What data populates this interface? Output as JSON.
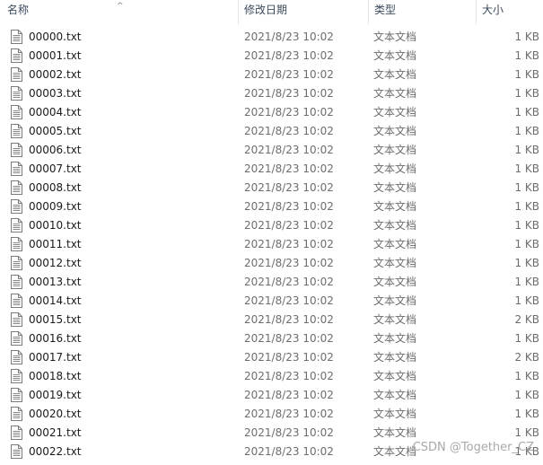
{
  "header": {
    "name": "名称",
    "date": "修改日期",
    "type": "类型",
    "size": "大小",
    "sort_indicator": "^"
  },
  "files": [
    {
      "name": "00000.txt",
      "date": "2021/8/23 10:02",
      "type": "文本文档",
      "size": "1 KB"
    },
    {
      "name": "00001.txt",
      "date": "2021/8/23 10:02",
      "type": "文本文档",
      "size": "1 KB"
    },
    {
      "name": "00002.txt",
      "date": "2021/8/23 10:02",
      "type": "文本文档",
      "size": "1 KB"
    },
    {
      "name": "00003.txt",
      "date": "2021/8/23 10:02",
      "type": "文本文档",
      "size": "1 KB"
    },
    {
      "name": "00004.txt",
      "date": "2021/8/23 10:02",
      "type": "文本文档",
      "size": "1 KB"
    },
    {
      "name": "00005.txt",
      "date": "2021/8/23 10:02",
      "type": "文本文档",
      "size": "1 KB"
    },
    {
      "name": "00006.txt",
      "date": "2021/8/23 10:02",
      "type": "文本文档",
      "size": "1 KB"
    },
    {
      "name": "00007.txt",
      "date": "2021/8/23 10:02",
      "type": "文本文档",
      "size": "1 KB"
    },
    {
      "name": "00008.txt",
      "date": "2021/8/23 10:02",
      "type": "文本文档",
      "size": "1 KB"
    },
    {
      "name": "00009.txt",
      "date": "2021/8/23 10:02",
      "type": "文本文档",
      "size": "1 KB"
    },
    {
      "name": "00010.txt",
      "date": "2021/8/23 10:02",
      "type": "文本文档",
      "size": "1 KB"
    },
    {
      "name": "00011.txt",
      "date": "2021/8/23 10:02",
      "type": "文本文档",
      "size": "1 KB"
    },
    {
      "name": "00012.txt",
      "date": "2021/8/23 10:02",
      "type": "文本文档",
      "size": "1 KB"
    },
    {
      "name": "00013.txt",
      "date": "2021/8/23 10:02",
      "type": "文本文档",
      "size": "1 KB"
    },
    {
      "name": "00014.txt",
      "date": "2021/8/23 10:02",
      "type": "文本文档",
      "size": "1 KB"
    },
    {
      "name": "00015.txt",
      "date": "2021/8/23 10:02",
      "type": "文本文档",
      "size": "2 KB"
    },
    {
      "name": "00016.txt",
      "date": "2021/8/23 10:02",
      "type": "文本文档",
      "size": "1 KB"
    },
    {
      "name": "00017.txt",
      "date": "2021/8/23 10:02",
      "type": "文本文档",
      "size": "2 KB"
    },
    {
      "name": "00018.txt",
      "date": "2021/8/23 10:02",
      "type": "文本文档",
      "size": "1 KB"
    },
    {
      "name": "00019.txt",
      "date": "2021/8/23 10:02",
      "type": "文本文档",
      "size": "1 KB"
    },
    {
      "name": "00020.txt",
      "date": "2021/8/23 10:02",
      "type": "文本文档",
      "size": "1 KB"
    },
    {
      "name": "00021.txt",
      "date": "2021/8/23 10:02",
      "type": "文本文档",
      "size": "1 KB"
    },
    {
      "name": "00022.txt",
      "date": "2021/8/23 10:02",
      "type": "文本文档",
      "size": "1 KB"
    }
  ],
  "icon": "text-file-icon",
  "watermark": "CSDN @Together_CZ"
}
